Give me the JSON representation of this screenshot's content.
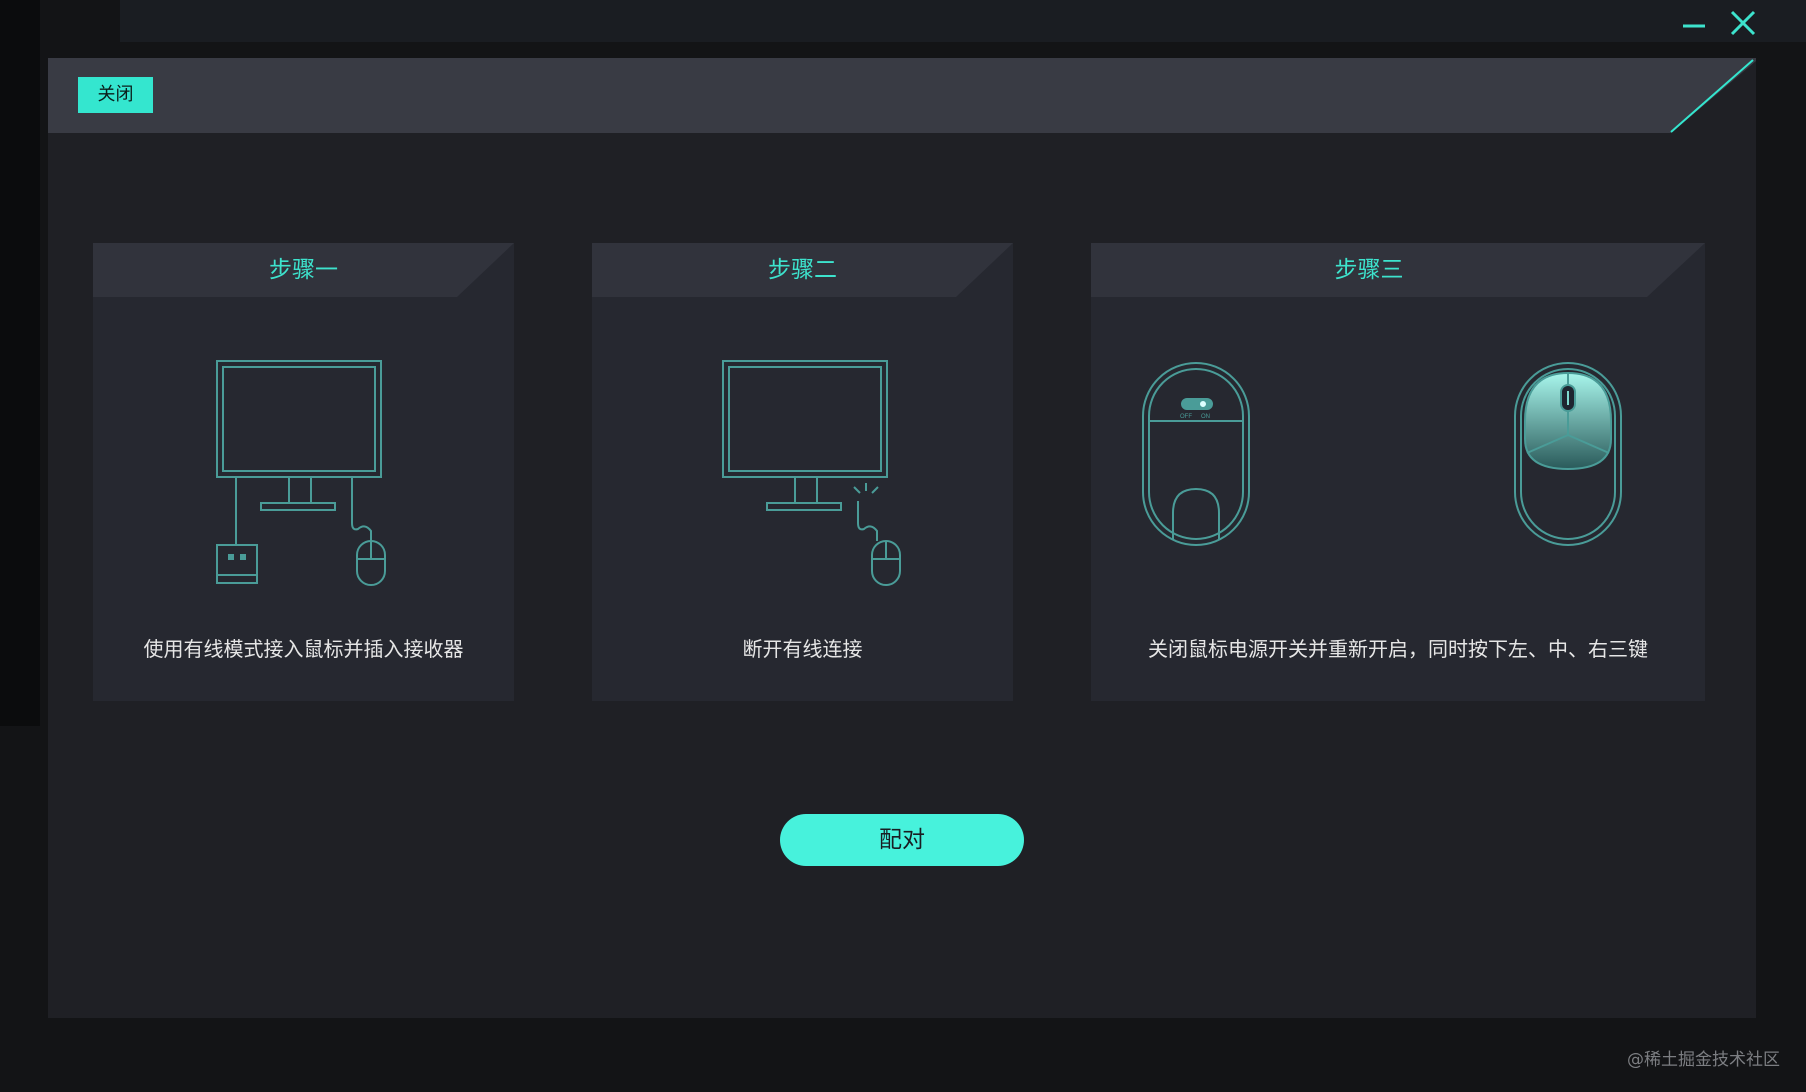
{
  "window": {
    "minimize_icon": "minus-icon",
    "close_icon": "x-icon"
  },
  "dialog": {
    "close_label": "关闭"
  },
  "steps": [
    {
      "title": "步骤一",
      "desc": "使用有线模式接入鼠标并插入接收器",
      "art_icon": "monitor-mouse-receiver-icon"
    },
    {
      "title": "步骤二",
      "desc": "断开有线连接",
      "art_icon": "monitor-disconnect-icon"
    },
    {
      "title": "步骤三",
      "desc": "关闭鼠标电源开关并重新开启，同时按下左、中、右三键",
      "art_icon": "mouse-power-buttons-icon",
      "switch_off": "OFF",
      "switch_on": "ON"
    }
  ],
  "pair_button": {
    "label": "配对"
  },
  "watermark": "@稀土掘金技术社区",
  "colors": {
    "accent": "#3de3cd",
    "button": "#47f2dc",
    "panel": "#262830",
    "background": "#1f2025"
  }
}
